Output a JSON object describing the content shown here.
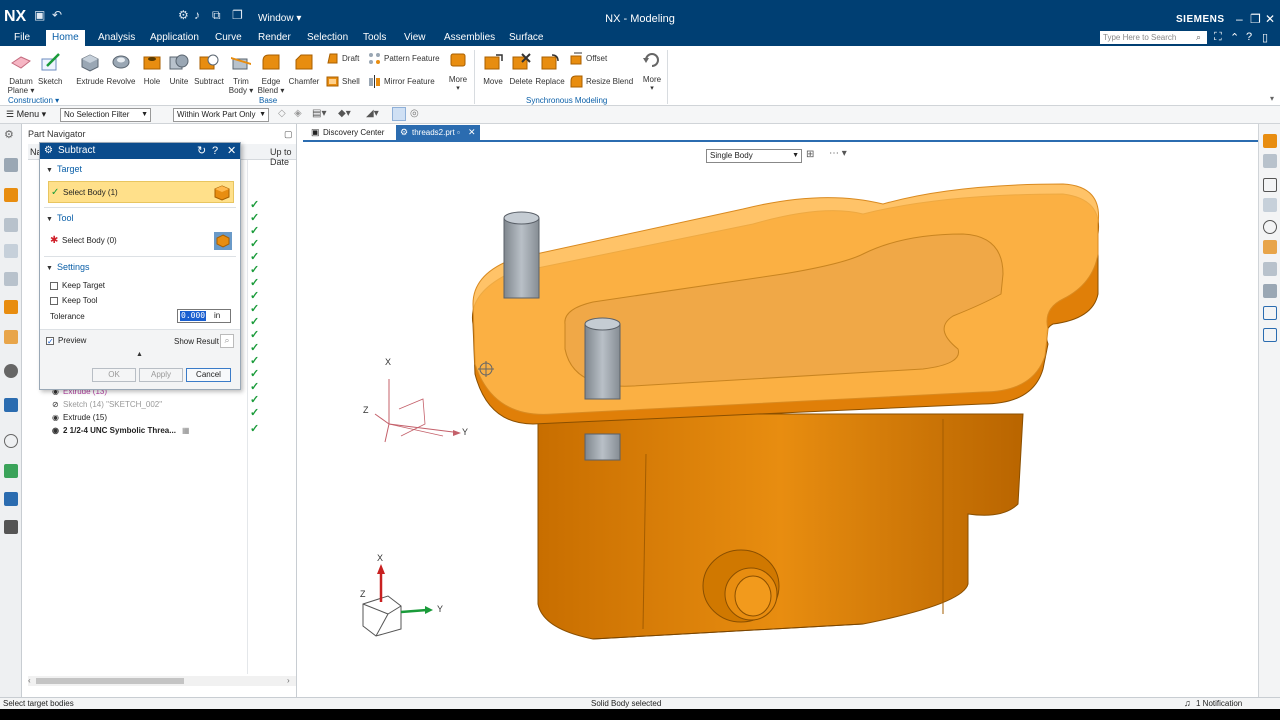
{
  "app": {
    "logo": "NX",
    "title": "NX - Modeling",
    "brand": "SIEMENS",
    "window_menu": "Window ▾"
  },
  "menu_tabs": [
    "File",
    "Home",
    "Analysis",
    "Application",
    "Curve",
    "Render",
    "Selection",
    "Tools",
    "View",
    "Assemblies",
    "Surface"
  ],
  "search_placeholder": "Type Here to Search",
  "ribbon": {
    "construction": {
      "datum_plane": "Datum Plane ▾",
      "sketch": "Sketch",
      "group_label": "Construction ▾"
    },
    "base": {
      "extrude": "Extrude",
      "revolve": "Revolve",
      "hole": "Hole",
      "unite": "Unite",
      "subtract": "Subtract",
      "trim_body": "Trim Body ▾",
      "edge_blend": "Edge Blend ▾",
      "chamfer": "Chamfer",
      "draft": "Draft",
      "shell": "Shell",
      "pattern_feature": "Pattern Feature",
      "mirror_feature": "Mirror Feature",
      "more": "More",
      "group_label": "Base"
    },
    "sync": {
      "move": "Move",
      "delete": "Delete",
      "replace": "Replace",
      "offset": "Offset",
      "resize_blend": "Resize Blend",
      "more": "More",
      "group_label": "Synchronous Modeling"
    }
  },
  "toolbar": {
    "menu": "☰ Menu ▾",
    "selection_filter": "No Selection Filter",
    "scope": "Within Work Part Only"
  },
  "part_navigator": {
    "title": "Part Navigator",
    "col_name": "Na",
    "col_uptodate": "Up to Date",
    "rows": [
      {
        "label": "Extrude (13)"
      },
      {
        "label": "Sketch (14) \"SKETCH_002\""
      },
      {
        "label": "Extrude (15)"
      },
      {
        "label": "2 1/2-4 UNC Symbolic Threa..."
      }
    ]
  },
  "dialog": {
    "title": "Subtract",
    "target_section": "Target",
    "target_select": "Select Body (1)",
    "tool_section": "Tool",
    "tool_select": "Select Body (0)",
    "settings_section": "Settings",
    "keep_target": "Keep Target",
    "keep_tool": "Keep Tool",
    "tolerance_label": "Tolerance",
    "tolerance_value": "0.000",
    "tolerance_unit": "in",
    "preview": "Preview",
    "show_result": "Show Result",
    "ok": "OK",
    "apply": "Apply",
    "cancel": "Cancel"
  },
  "graphics": {
    "tab_discovery": "Discovery Center",
    "tab_part": "threads2.prt",
    "body_filter": "Single Body",
    "axis_x": "X",
    "axis_y": "Y",
    "axis_z": "Z"
  },
  "status": {
    "left": "Select target bodies",
    "center": "Solid Body selected",
    "right": "1 Notification"
  },
  "colors": {
    "title_bar": "#003f73",
    "orange_body": "#e88d10",
    "translucent_plate": "#ffb84d",
    "accent": "#0a5fa8"
  }
}
